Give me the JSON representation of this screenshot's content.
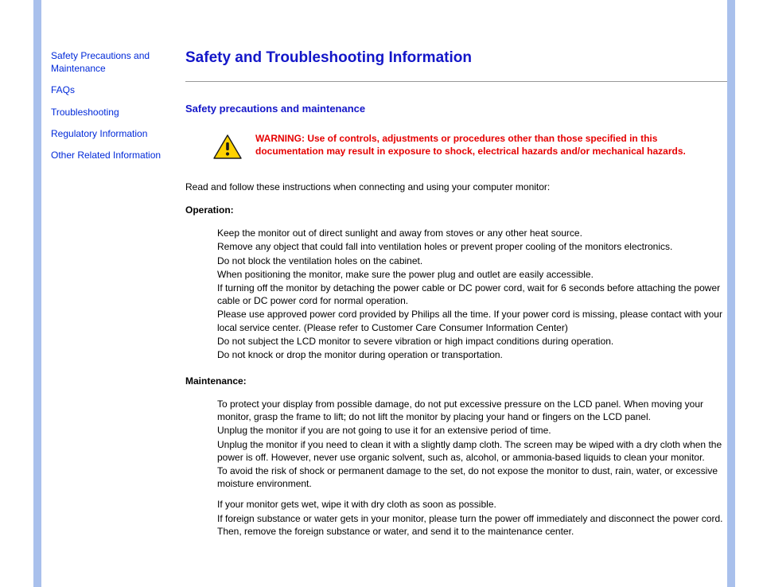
{
  "sidebar": {
    "links": [
      "Safety Precautions and Maintenance",
      "FAQs",
      "Troubleshooting",
      "Regulatory Information",
      "Other Related Information"
    ]
  },
  "main": {
    "title": "Safety and Troubleshooting Information",
    "section_heading": "Safety precautions and maintenance",
    "warning": "WARNING: Use of controls, adjustments or procedures other than those specified in this documentation may result in exposure to shock, electrical hazards and/or mechanical hazards.",
    "intro": "Read and follow these instructions when connecting and using your computer monitor:",
    "operation_heading": "Operation:",
    "operation_items": [
      "Keep the monitor out of direct sunlight and away from stoves or any other heat source.",
      "Remove any object that could fall into ventilation holes or prevent proper cooling of the monitors electronics.",
      "Do not block the ventilation holes on the cabinet.",
      "When positioning the monitor, make sure the power plug and outlet are easily accessible.",
      "If turning off the monitor by detaching the power cable or DC power cord, wait for 6 seconds before attaching the power cable or DC power cord for normal operation.",
      "Please use approved power cord provided by Philips all the time. If your power cord is missing, please contact with your local service center. (Please refer to Customer Care Consumer Information Center)",
      "Do not subject the LCD monitor to severe vibration or high impact conditions during operation.",
      "Do not knock or drop the monitor during operation or transportation."
    ],
    "maintenance_heading": "Maintenance:",
    "maintenance_items": [
      "To protect your display from possible damage, do not put excessive pressure on the LCD panel. When moving your monitor, grasp the frame to lift; do not lift the monitor by placing your hand or fingers on the LCD panel.",
      "Unplug the monitor if you are not going to use it for an extensive period of time.",
      "Unplug the monitor if you need to clean it with a slightly damp cloth. The screen may be wiped with a dry cloth when the power is off. However, never use organic solvent, such as, alcohol, or ammonia-based liquids to clean your monitor.",
      "To avoid the risk of shock or permanent damage to the set, do not expose the monitor to dust, rain, water, or excessive moisture environment."
    ],
    "maintenance_items_2": [
      "If your monitor gets wet, wipe it with dry cloth as soon as possible.",
      "If foreign substance or water gets in your monitor, please turn the power off immediately and disconnect the power cord. Then, remove the foreign substance or water, and send it to the maintenance center."
    ]
  }
}
